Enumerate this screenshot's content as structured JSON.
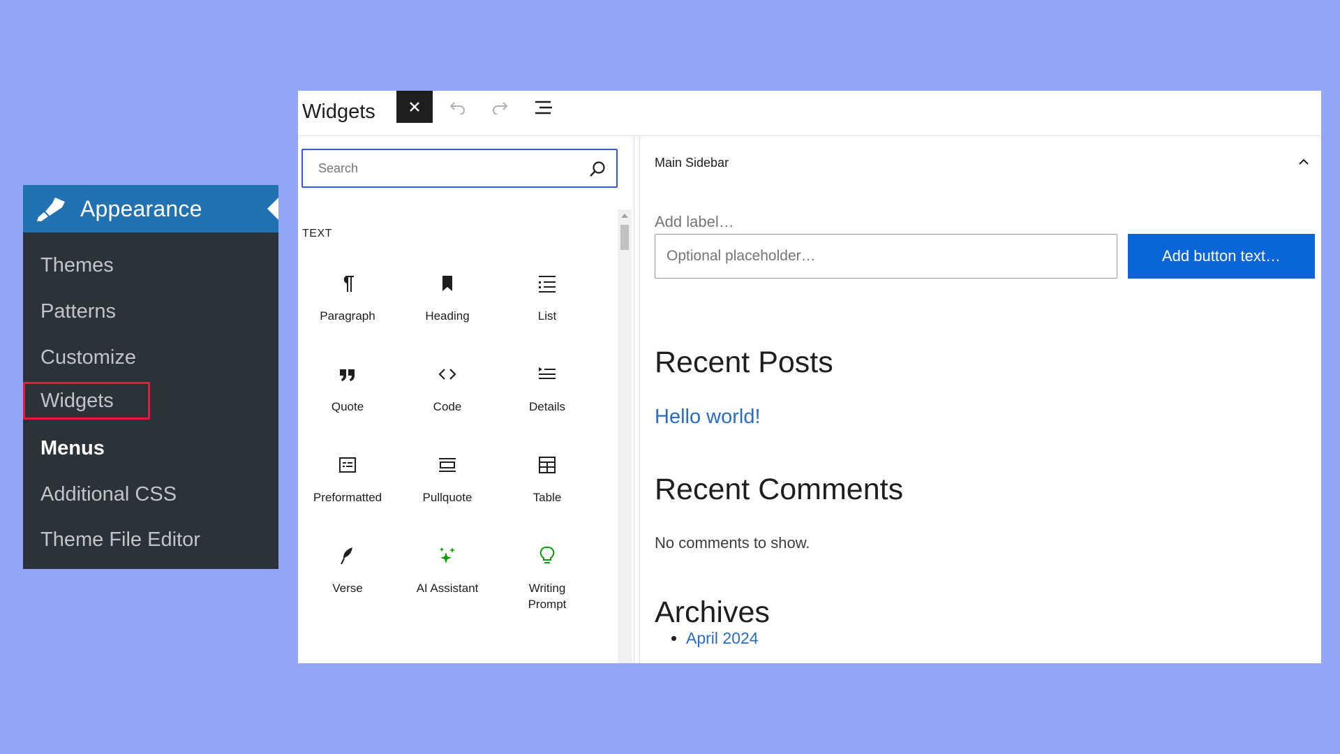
{
  "admin_menu": {
    "header_label": "Appearance",
    "items": [
      {
        "label": "Themes"
      },
      {
        "label": "Patterns"
      },
      {
        "label": "Customize"
      },
      {
        "label": "Widgets"
      },
      {
        "label": "Menus"
      },
      {
        "label": "Additional CSS"
      },
      {
        "label": "Theme File Editor"
      }
    ]
  },
  "toolbar": {
    "title": "Widgets",
    "close_icon": "close-icon",
    "undo_icon": "undo-icon",
    "redo_icon": "redo-icon",
    "list_view_icon": "list-view-icon"
  },
  "inserter": {
    "search_placeholder": "Search",
    "category": "TEXT",
    "blocks": [
      {
        "label": "Paragraph",
        "icon": "paragraph-icon"
      },
      {
        "label": "Heading",
        "icon": "heading-icon"
      },
      {
        "label": "List",
        "icon": "list-icon"
      },
      {
        "label": "Quote",
        "icon": "quote-icon"
      },
      {
        "label": "Code",
        "icon": "code-icon"
      },
      {
        "label": "Details",
        "icon": "details-icon"
      },
      {
        "label": "Preformatted",
        "icon": "preformatted-icon"
      },
      {
        "label": "Pullquote",
        "icon": "pullquote-icon"
      },
      {
        "label": "Table",
        "icon": "table-icon"
      },
      {
        "label": "Verse",
        "icon": "verse-icon"
      },
      {
        "label": "AI Assistant",
        "icon": "sparkle-icon"
      },
      {
        "label": "Writing Prompt",
        "icon": "lightbulb-icon"
      }
    ],
    "accent_color": "#3858e9",
    "ai_icon_color": "#069e08"
  },
  "main_sidebar": {
    "title": "Main Sidebar",
    "search_widget": {
      "label_placeholder": "Add label…",
      "input_placeholder": "Optional placeholder…",
      "button_text": "Add button text…"
    },
    "recent_posts": {
      "heading": "Recent Posts",
      "posts": [
        "Hello world!"
      ]
    },
    "recent_comments": {
      "heading": "Recent Comments",
      "empty_text": "No comments to show."
    },
    "archives": {
      "heading": "Archives",
      "items": [
        "April 2024"
      ]
    },
    "button_color": "#0a66d6",
    "link_color": "#2a6cc4"
  },
  "colors": {
    "background": "#95a5f7",
    "admin_menu_bg": "#2c3338",
    "admin_header_bg": "#2271b1",
    "highlight_border": "#e31c3d"
  }
}
